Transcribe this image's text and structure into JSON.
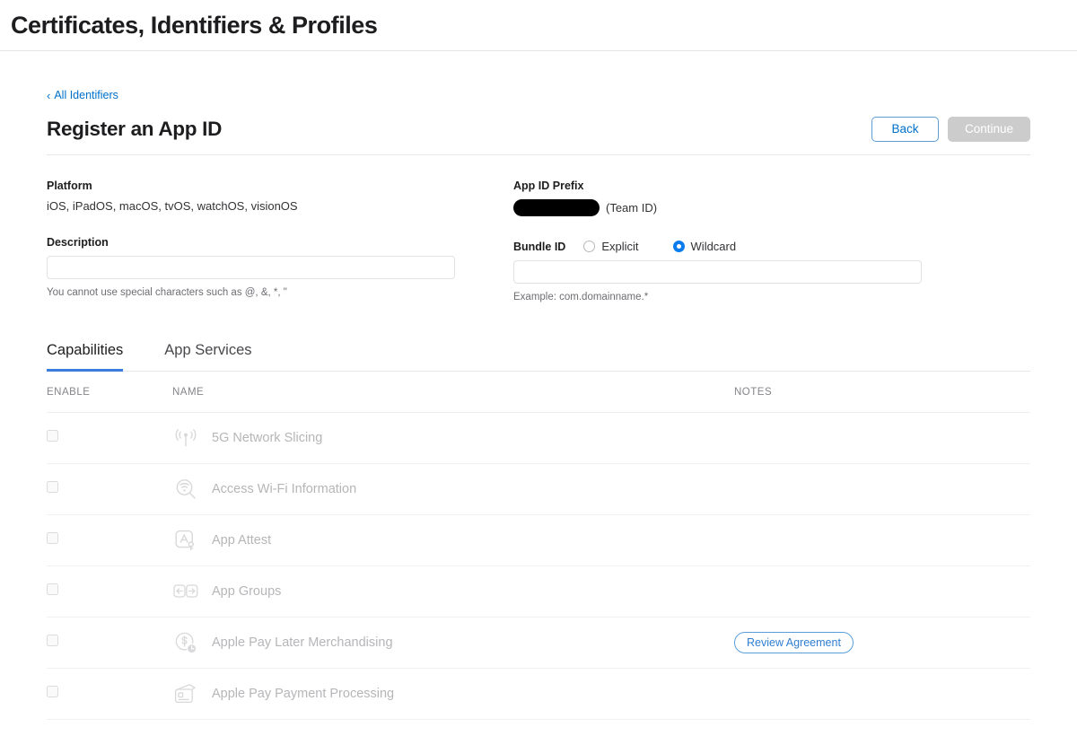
{
  "header": {
    "title": "Certificates, Identifiers & Profiles"
  },
  "breadcrumb": {
    "chevron": "‹",
    "label": "All Identifiers"
  },
  "page": {
    "title": "Register an App ID",
    "back_label": "Back",
    "continue_label": "Continue"
  },
  "form": {
    "platform_label": "Platform",
    "platform_value": "iOS, iPadOS, macOS, tvOS, watchOS, visionOS",
    "description_label": "Description",
    "description_value": "",
    "description_hint": "You cannot use special characters such as @, &, *, \"",
    "prefix_label": "App ID Prefix",
    "prefix_value": "",
    "prefix_suffix": "(Team ID)",
    "bundle_label": "Bundle ID",
    "bundle_options": [
      {
        "label": "Explicit",
        "selected": false
      },
      {
        "label": "Wildcard",
        "selected": true
      }
    ],
    "bundle_value": "",
    "bundle_hint": "Example: com.domainname.*"
  },
  "tabs": [
    {
      "label": "Capabilities",
      "active": true
    },
    {
      "label": "App Services",
      "active": false
    }
  ],
  "table": {
    "columns": {
      "enable": "ENABLE",
      "name": "NAME",
      "notes": "NOTES"
    },
    "rows": [
      {
        "name": "5G Network Slicing",
        "icon": "broadcast-antenna-icon",
        "checked": false,
        "note": ""
      },
      {
        "name": "Access Wi-Fi Information",
        "icon": "wifi-magnifier-icon",
        "checked": false,
        "note": ""
      },
      {
        "name": "App Attest",
        "icon": "app-attest-key-icon",
        "checked": false,
        "note": ""
      },
      {
        "name": "App Groups",
        "icon": "app-groups-arrows-icon",
        "checked": false,
        "note": ""
      },
      {
        "name": "Apple Pay Later Merchandising",
        "icon": "dollar-clock-icon",
        "checked": false,
        "note": "Review Agreement"
      },
      {
        "name": "Apple Pay Payment Processing",
        "icon": "payment-cards-icon",
        "checked": false,
        "note": ""
      }
    ]
  },
  "colors": {
    "link": "#0070c9",
    "accent": "#3b7ddd",
    "radio_selected": "#0a7ced",
    "disabled_button": "#cccccc",
    "text_primary": "#1d1d1f",
    "text_muted": "#b6b6b9"
  }
}
